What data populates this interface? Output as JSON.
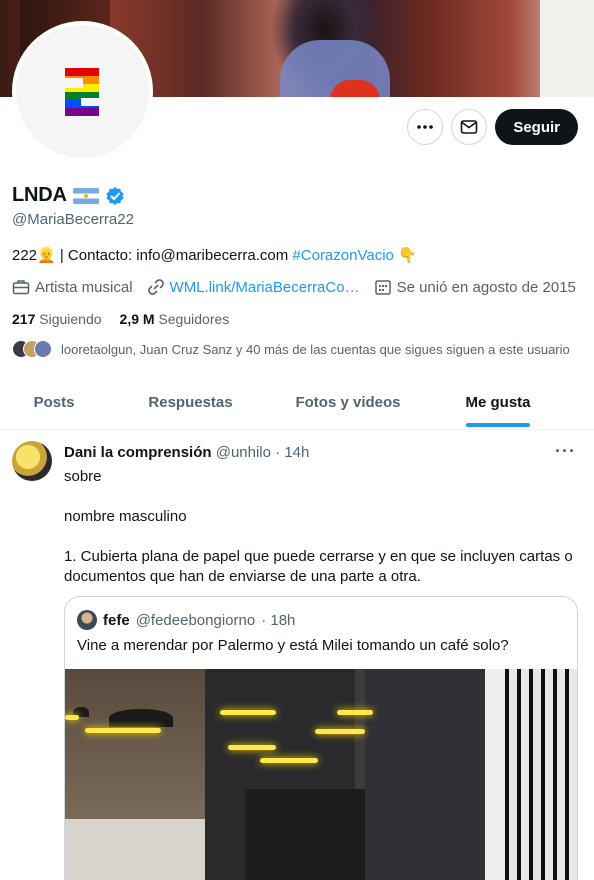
{
  "profile": {
    "name": "LNDA",
    "handle": "@MariaBecerra22",
    "bio_prefix": "222👱 | Contacto: info@maribecerra.com ",
    "bio_hashtag": "#CorazonVacio",
    "bio_suffix": " 👇",
    "category": "Artista musical",
    "website": "WML.link/MariaBecerraCo…",
    "joined": "Se unió en agosto de 2015",
    "following_count": "217",
    "following_label": "Siguiendo",
    "followers_count": "2,9 M",
    "followers_label": "Seguidores",
    "followed_by": "looretaolgun, Juan Cruz Sanz y 40 más de las cuentas que sigues siguen a este usuario"
  },
  "actions": {
    "follow_label": "Seguir",
    "more_icon": "more-icon",
    "message_icon": "message-icon"
  },
  "tabs": [
    {
      "label": "Posts"
    },
    {
      "label": "Respuestas"
    },
    {
      "label": "Fotos y videos"
    },
    {
      "label": "Me gusta"
    }
  ],
  "active_tab": "Me gusta",
  "post": {
    "author_name": "Dani la comprensión",
    "author_handle": "@unhilo",
    "time": "· 14h",
    "more": "···",
    "paragraphs": [
      "sobre",
      "nombre masculino",
      "1. Cubierta plana de papel que puede cerrarse y en que se incluyen cartas o documentos que han de enviarse de una parte a otra."
    ],
    "quote": {
      "author_name": "fefe",
      "author_handle": "@fedeebongiorno",
      "time": "· 18h",
      "text": "Vine a merendar por Palermo y está Milei tomando un café solo?"
    }
  },
  "colors": {
    "accent": "#1d9bf0",
    "text": "#0f1419",
    "muted": "#536471",
    "verified": "#1d9bf0"
  }
}
